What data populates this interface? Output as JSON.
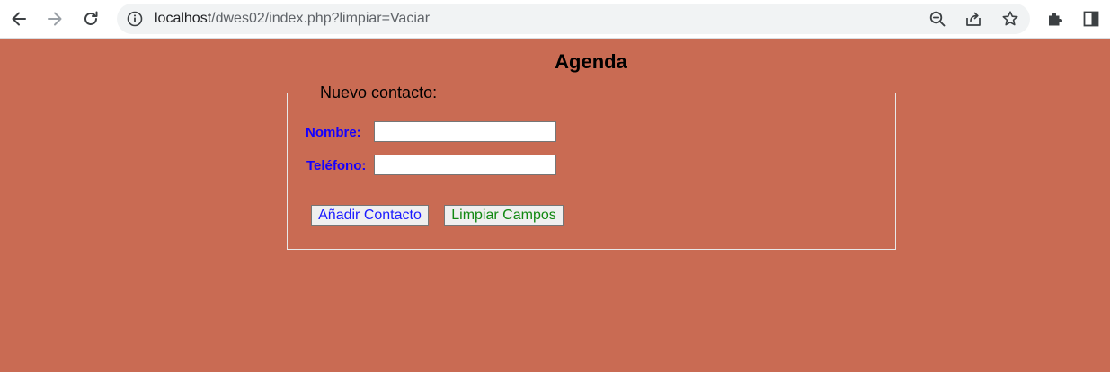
{
  "browser": {
    "url_host": "localhost",
    "url_path": "/dwes02/index.php?limpiar=Vaciar"
  },
  "page": {
    "title": "Agenda",
    "background_color": "#c96b53"
  },
  "form": {
    "legend": "Nuevo contacto:",
    "name_label": "Nombre:",
    "name_value": "",
    "phone_label": "Teléfono:",
    "phone_value": "",
    "add_button_label": "Añadir Contacto",
    "clear_button_label": "Limpiar Campos",
    "label_color": "#1400ff",
    "add_button_color": "#1a1aff",
    "clear_button_color": "#118811"
  }
}
